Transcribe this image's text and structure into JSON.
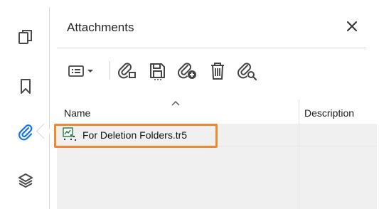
{
  "left_rail": {
    "items": [
      {
        "name": "pages",
        "icon": "pages-copy-icon"
      },
      {
        "name": "bookmarks",
        "icon": "bookmark-icon"
      },
      {
        "name": "attachments",
        "icon": "paperclip-icon",
        "active": true
      },
      {
        "name": "layers",
        "icon": "layers-icon"
      }
    ],
    "active_color": "#1473e6",
    "icon_color": "#4b4b4b"
  },
  "panel": {
    "title": "Attachments",
    "close_icon": "close-icon"
  },
  "toolbar": {
    "buttons": [
      {
        "name": "options-menu",
        "icon": "list-options-icon"
      },
      {
        "name": "open-attachment",
        "icon": "open-attachment-icon"
      },
      {
        "name": "save-attachment",
        "icon": "save-attachment-icon"
      },
      {
        "name": "add-attachment",
        "icon": "add-attachment-icon"
      },
      {
        "name": "delete-attachment",
        "icon": "trash-icon"
      },
      {
        "name": "search-attachments",
        "icon": "search-attachment-icon"
      }
    ]
  },
  "table": {
    "columns": {
      "name": "Name",
      "description": "Description"
    },
    "rows": [
      {
        "file_name": "For Deletion Folders.tr5",
        "icon": "file-icon"
      }
    ],
    "highlight_color": "#ec8a2e"
  }
}
